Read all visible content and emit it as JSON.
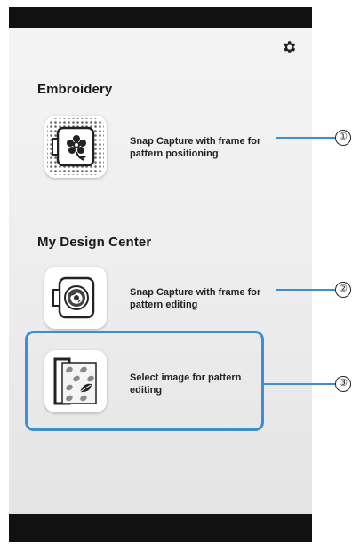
{
  "header": {
    "settings_icon": "gear-icon"
  },
  "sections": [
    {
      "title": "Embroidery",
      "items": [
        {
          "label": "Snap Capture with frame for pattern positioning",
          "icon": "embroidery-frame-flower-icon",
          "callout": "①"
        }
      ]
    },
    {
      "title": "My Design Center",
      "items": [
        {
          "label": "Snap Capture with frame for pattern editing",
          "icon": "design-frame-pattern-icon",
          "callout": "②"
        },
        {
          "label": "Select image for pattern editing",
          "icon": "image-gallery-leaves-icon",
          "callout": "③"
        }
      ]
    }
  ],
  "colors": {
    "accent": "#3a8fd6",
    "background": "#efefef",
    "chrome": "#111111"
  }
}
